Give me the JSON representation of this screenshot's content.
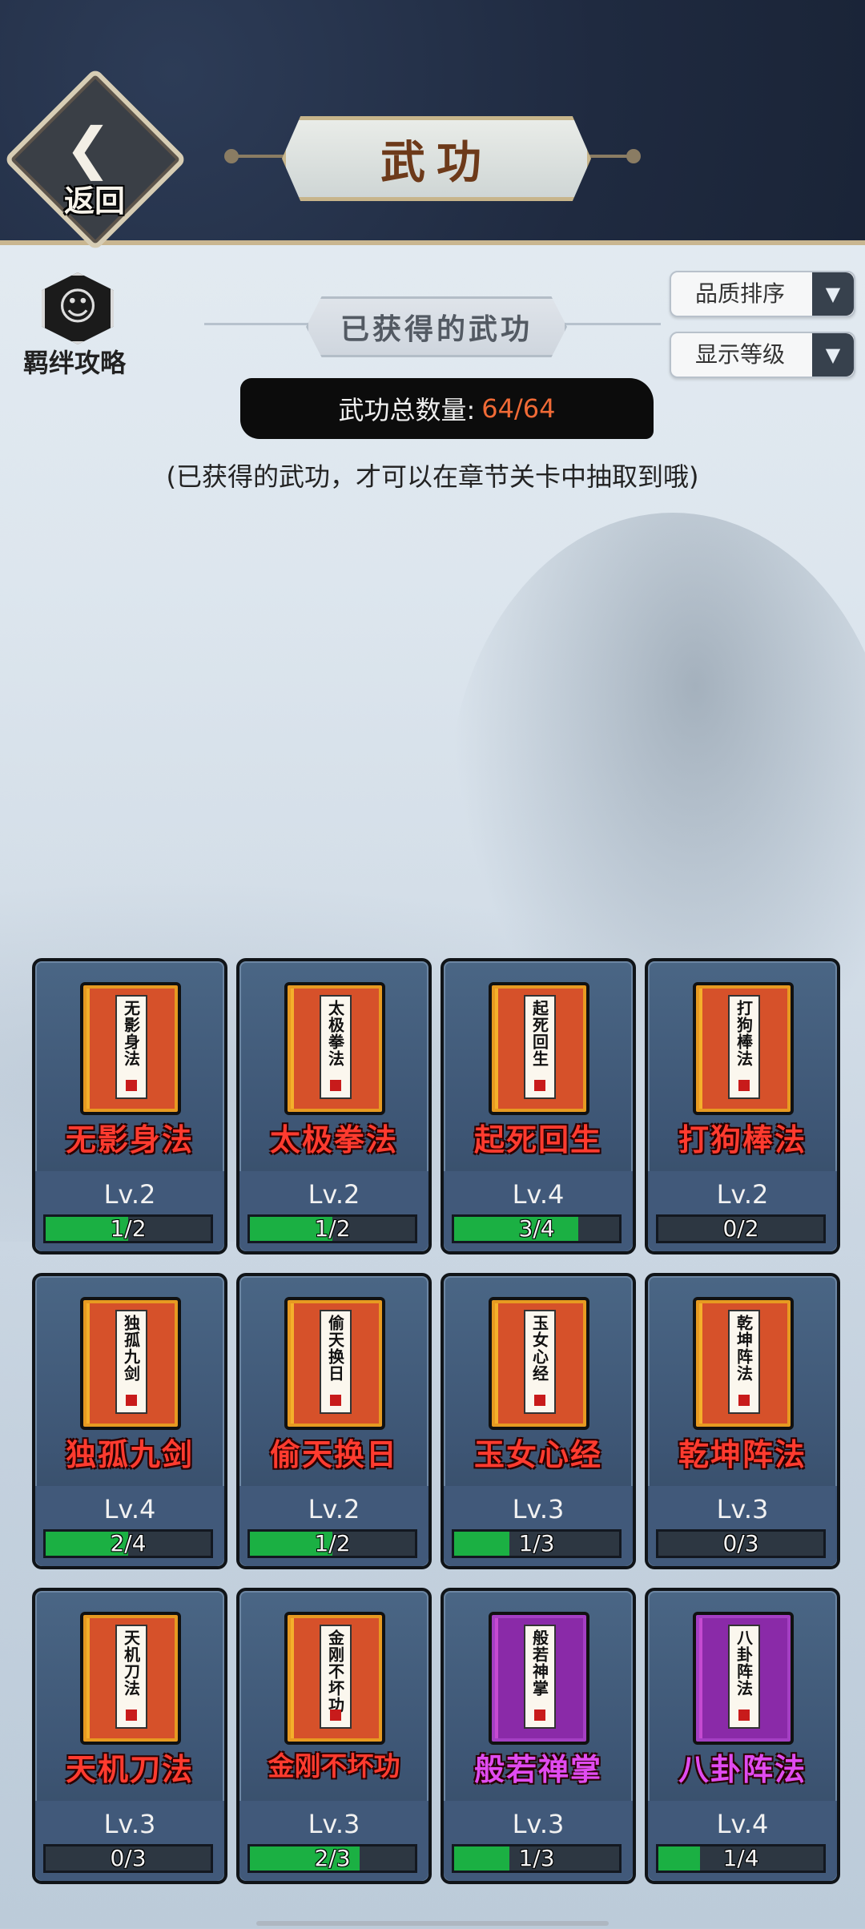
{
  "header": {
    "back_label": "返回",
    "back_icon": "back-arrow-icon",
    "title": "武功"
  },
  "strategy": {
    "label": "羁绊攻略",
    "icon": "meditation-icon"
  },
  "obtained_section": {
    "title": "已获得的武功"
  },
  "sort_dropdowns": [
    {
      "label": "品质排序",
      "icon": "triangle-down-icon"
    },
    {
      "label": "显示等级",
      "icon": "triangle-down-icon"
    }
  ],
  "total": {
    "label": "武功总数量:",
    "value": "64/64",
    "value_color": "#f06a36"
  },
  "hint": "(已获得的武功，才可以在章节关卡中抽取到哦)",
  "colors": {
    "name_red": "#ff3b2f",
    "name_purple": "#e04bf0",
    "progress_green": "#1bb043"
  },
  "cards": [
    {
      "name": "无影身法",
      "book_text": "无影身法",
      "level": "Lv.2",
      "progress": "1/2",
      "fraction": 0.5,
      "quality": "orange"
    },
    {
      "name": "太极拳法",
      "book_text": "太极拳法",
      "level": "Lv.2",
      "progress": "1/2",
      "fraction": 0.5,
      "quality": "orange"
    },
    {
      "name": "起死回生",
      "book_text": "起死回生",
      "level": "Lv.4",
      "progress": "3/4",
      "fraction": 0.75,
      "quality": "orange"
    },
    {
      "name": "打狗棒法",
      "book_text": "打狗棒法",
      "level": "Lv.2",
      "progress": "0/2",
      "fraction": 0,
      "quality": "orange"
    },
    {
      "name": "独孤九剑",
      "book_text": "独孤九剑",
      "level": "Lv.4",
      "progress": "2/4",
      "fraction": 0.5,
      "quality": "orange"
    },
    {
      "name": "偷天换日",
      "book_text": "偷天换日",
      "level": "Lv.2",
      "progress": "1/2",
      "fraction": 0.5,
      "quality": "orange"
    },
    {
      "name": "玉女心经",
      "book_text": "玉女心经",
      "level": "Lv.3",
      "progress": "1/3",
      "fraction": 0.333,
      "quality": "orange"
    },
    {
      "name": "乾坤阵法",
      "book_text": "乾坤阵法",
      "level": "Lv.3",
      "progress": "0/3",
      "fraction": 0,
      "quality": "orange"
    },
    {
      "name": "天机刀法",
      "book_text": "天机刀法",
      "level": "Lv.3",
      "progress": "0/3",
      "fraction": 0,
      "quality": "orange"
    },
    {
      "name": "金刚不坏功",
      "book_text": "金刚不坏功",
      "level": "Lv.3",
      "progress": "2/3",
      "fraction": 0.667,
      "quality": "orange"
    },
    {
      "name": "般若禅掌",
      "book_text": "般若神掌",
      "level": "Lv.3",
      "progress": "1/3",
      "fraction": 0.333,
      "quality": "purple"
    },
    {
      "name": "八卦阵法",
      "book_text": "八卦阵法",
      "level": "Lv.4",
      "progress": "1/4",
      "fraction": 0.25,
      "quality": "purple"
    }
  ]
}
